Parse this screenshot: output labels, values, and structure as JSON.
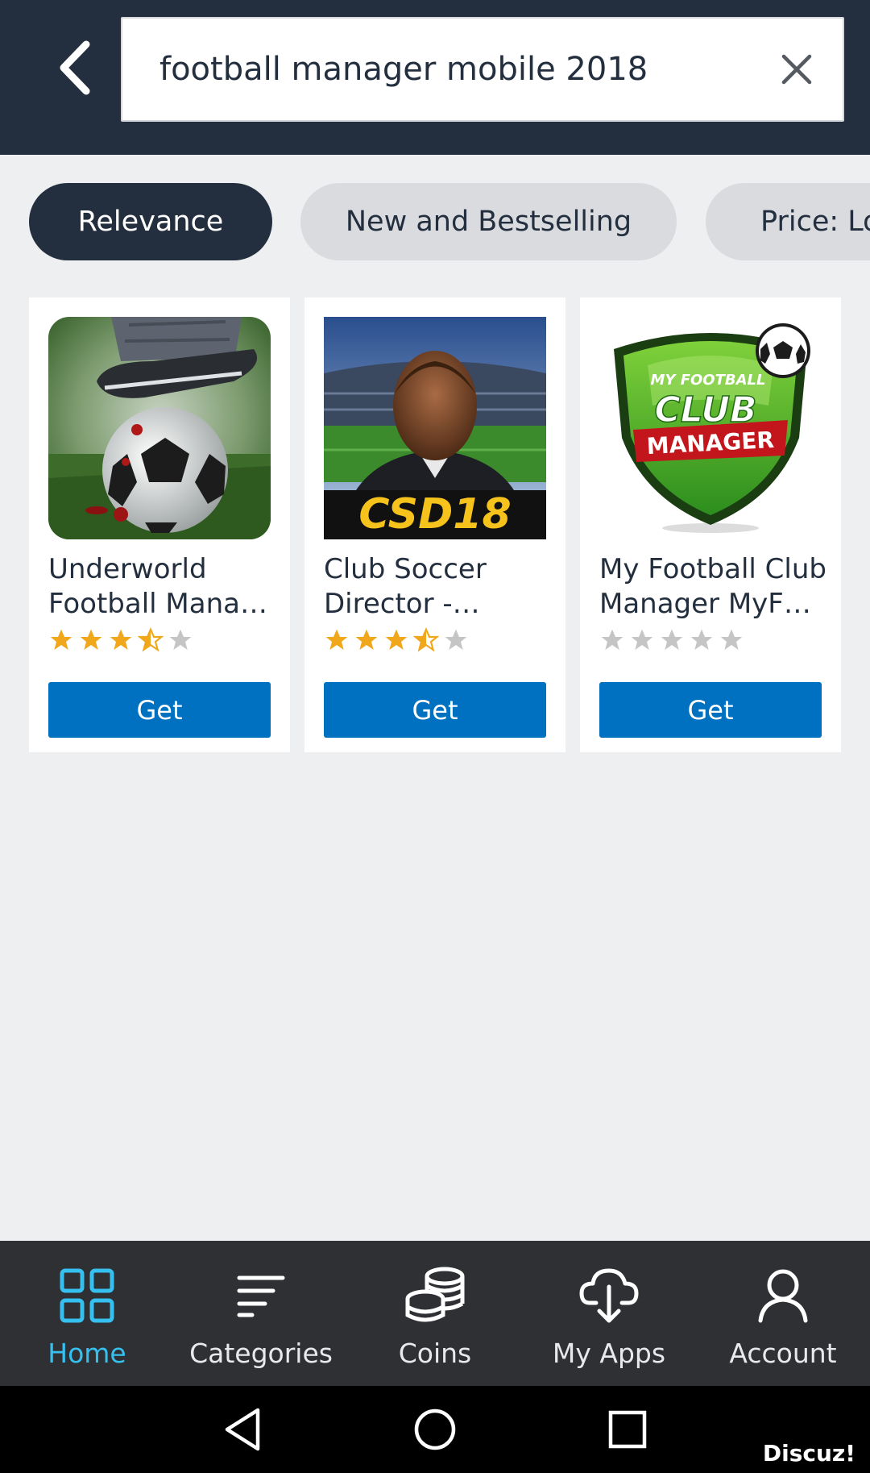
{
  "search": {
    "query": "football manager mobile 2018"
  },
  "sort_chips": [
    {
      "label": "Relevance",
      "active": true
    },
    {
      "label": "New and Bestselling",
      "active": false
    },
    {
      "label": "Price: Lo",
      "active": false
    }
  ],
  "results": [
    {
      "title": "Underworld Football Mana…",
      "rating": 3.5,
      "button": "Get",
      "icon": "underworld-football-app-icon"
    },
    {
      "title": "Club Soccer Director - Socc…",
      "rating": 3.5,
      "button": "Get",
      "icon": "club-soccer-director-app-icon",
      "icon_text": "CSD18"
    },
    {
      "title": "My Football Club Manager MyFC ..",
      "rating": 0,
      "button": "Get",
      "icon": "my-football-club-manager-app-icon",
      "icon_text": [
        "MY FOOTBALL",
        "CLUB",
        "MANAGER"
      ]
    }
  ],
  "bottom_nav": [
    {
      "label": "Home",
      "icon": "home-grid-icon",
      "active": true
    },
    {
      "label": "Categories",
      "icon": "categories-lines-icon",
      "active": false
    },
    {
      "label": "Coins",
      "icon": "coins-stack-icon",
      "active": false
    },
    {
      "label": "My Apps",
      "icon": "cloud-download-icon",
      "active": false
    },
    {
      "label": "Account",
      "icon": "person-icon",
      "active": false
    }
  ],
  "colors": {
    "header_bg": "#232f3e",
    "page_bg": "#eeeff1",
    "get_button": "#0070c0",
    "star_filled": "#f0a71b",
    "star_empty": "#c5c5c5",
    "nav_active": "#36c0f0"
  },
  "watermark": "Discuz!"
}
